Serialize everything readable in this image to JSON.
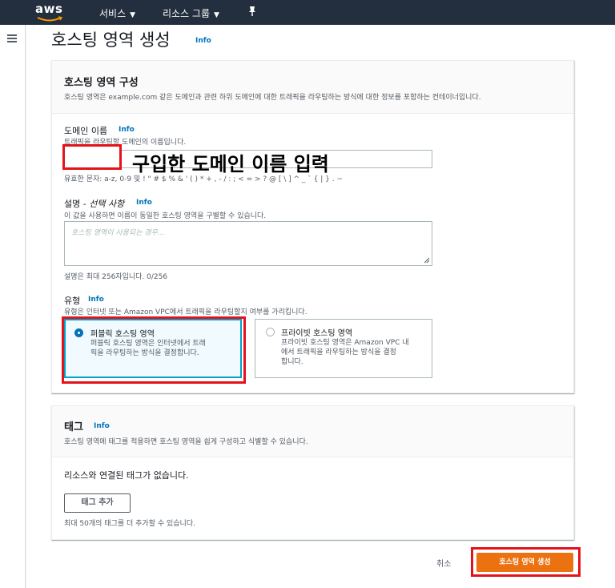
{
  "nav": {
    "logo": "aws",
    "services": "서비스",
    "resource_groups": "리소스 그룹"
  },
  "page": {
    "title": "호스팅 영역 생성",
    "info": "Info"
  },
  "config_panel": {
    "heading": "호스팅 영역 구성",
    "description": "호스팅 영역은 example.com 같은 도메인과 관련 하위 도메인에 대한 트래픽을 라우팅하는 방식에 대한 정보를 포함하는 컨테이너입니다.",
    "domain": {
      "label": "도메인 이름",
      "info": "Info",
      "hint": "트래픽을 라우팅할 도메인의 이름입니다.",
      "value": "",
      "constraint": "유효한 문자: a-z, 0-9 및 ! \" # $ % & ' ( ) * + , - / : ; < = > ? @ [ \\ ] ^ _ ` { | } . ~"
    },
    "description_field": {
      "label_main": "설명 - ",
      "label_optional": "선택 사항",
      "info": "Info",
      "hint": "이 값을 사용하면 이름이 동일한 호스팅 영역을 구별할 수 있습니다.",
      "placeholder": "호스팅 영역이 사용되는 경우...",
      "counter": "설명은 최대 256자입니다. 0/256"
    },
    "type": {
      "label": "유형",
      "info": "Info",
      "hint": "유형은 인터넷 또는 Amazon VPC에서 트래픽을 라우팅할지 여부를 가리킵니다.",
      "options": [
        {
          "title": "퍼블릭 호스팅 영역",
          "desc_line1": "퍼블릭 호스팅 영역은 인터넷에서 트래",
          "desc_line2": "픽을 라우팅하는 방식을 결정합니다.",
          "selected": true
        },
        {
          "title": "프라이빗 호스팅 영역",
          "desc_line1": "프라이빗 호스팅 영역은 Amazon VPC 내",
          "desc_line2": "에서 트래픽을 라우팅하는 방식을 결정",
          "desc_line3": "합니다.",
          "selected": false
        }
      ]
    }
  },
  "tags_panel": {
    "heading": "태그",
    "info": "Info",
    "description": "호스팅 영역에 태그를 적용하면 호스팅 영역을 쉽게 구성하고 식별할 수 있습니다.",
    "empty": "리소스와 연결된 태그가 없습니다.",
    "add_button": "태그 추가",
    "limit": "최대 50개의 태그를 더 추가할 수 있습니다."
  },
  "footer": {
    "cancel": "취소",
    "submit": "호스팅 영역 생성"
  },
  "annotation": {
    "text": "구입한 도메인 이름 입력"
  },
  "colors": {
    "nav_bg": "#232f3e",
    "accent": "#ec7211",
    "link": "#0073bb",
    "annotation": "#e3121b",
    "selected_border": "#00a1c9"
  }
}
